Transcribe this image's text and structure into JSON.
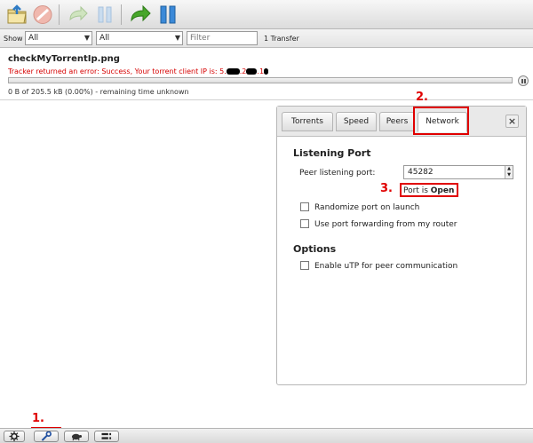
{
  "toolbar": {
    "buttons": [
      {
        "name": "open-torrent-icon",
        "color": "#6aa6d8"
      },
      {
        "name": "remove-torrent-icon",
        "color": "#e07a6a"
      },
      {
        "name": "resume-icon",
        "color": "#9ac77e"
      },
      {
        "name": "pause-icon",
        "color": "#8fb6dc"
      },
      {
        "name": "resume-all-icon",
        "color": "#3fa01e"
      },
      {
        "name": "pause-all-icon",
        "color": "#2f7fd0"
      }
    ]
  },
  "filter": {
    "show_label": "Show",
    "state_selected": "All",
    "tracker_selected": "All",
    "search_placeholder": "Filter",
    "transfer_count": "1 Transfer"
  },
  "torrent": {
    "name": "checkMyTorrentIp.png",
    "error_prefix": "Tracker returned an error: Success, Your torrent client IP is: 5.",
    "error_mid1": ".2",
    "error_mid2": ".1",
    "progress_percent": 0,
    "stats": "0 B of 205.5 kB (0.00%) - remaining time unknown"
  },
  "dialog": {
    "tabs": [
      "Torrents",
      "Speed",
      "Peers",
      "Network"
    ],
    "active_tab": "Network",
    "close_label": "×",
    "listening": {
      "title": "Listening Port",
      "port_label": "Peer listening port:",
      "port_value": "45282",
      "status_prefix": "Port is ",
      "status_value": "Open",
      "randomize_label": "Randomize port on launch",
      "forwarding_label": "Use port forwarding from my router"
    },
    "options": {
      "title": "Options",
      "utp_label": "Enable uTP for peer communication"
    }
  },
  "annotations": {
    "step1": "1.",
    "step2": "2.",
    "step3": "3.",
    "color": "#e00000"
  },
  "bottombar": {
    "buttons": [
      "gear-icon",
      "wrench-icon",
      "turtle-icon",
      "sort-icon"
    ]
  }
}
